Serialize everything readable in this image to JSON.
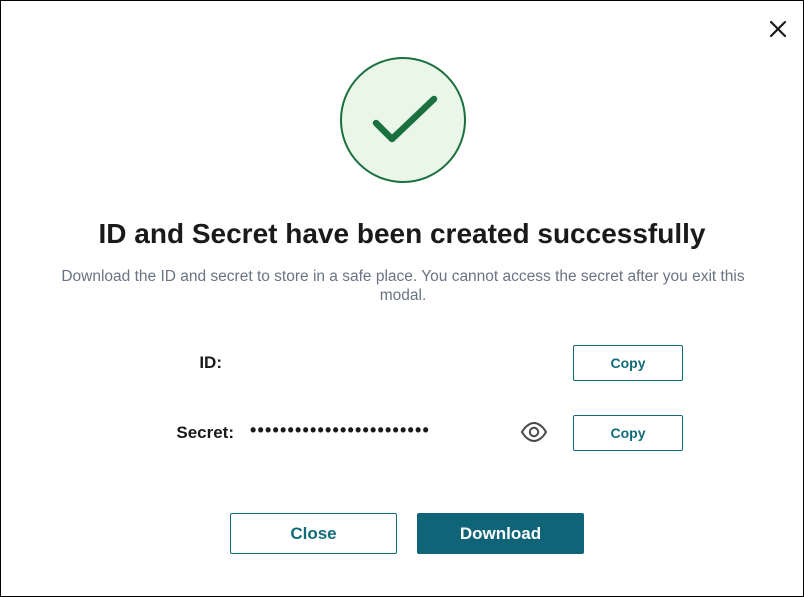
{
  "modal": {
    "title": "ID and Secret have been created successfully",
    "subtitle": "Download the ID and secret to store in a safe place. You cannot access the secret after you exit this modal.",
    "close_icon": "close-icon",
    "success_icon": "checkmark-icon"
  },
  "fields": {
    "id": {
      "label": "ID:",
      "value": "",
      "copy_label": "Copy"
    },
    "secret": {
      "label": "Secret:",
      "value": "••••••••••••••••••••••••",
      "reveal_icon": "eye-icon",
      "copy_label": "Copy"
    }
  },
  "footer": {
    "close_label": "Close",
    "download_label": "Download"
  },
  "colors": {
    "accent": "#0f6577",
    "success": "#1b7040",
    "success_bg": "#eaf6e8",
    "muted_text": "#6a7383"
  }
}
